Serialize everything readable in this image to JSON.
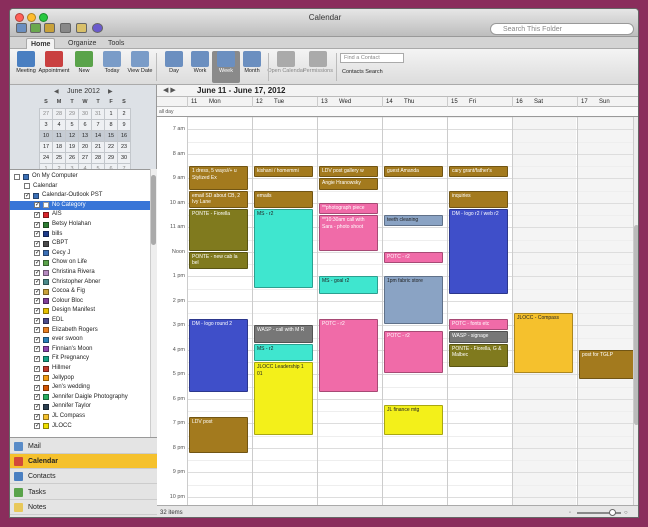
{
  "window": {
    "title": "Calendar",
    "search_placeholder": "Search This Folder"
  },
  "ribbon_tabs": [
    "Home",
    "Organize",
    "Tools"
  ],
  "ribbon_buttons": [
    {
      "label": "Meeting",
      "icon": "meeting-icon",
      "color": "#4a7fc1"
    },
    {
      "label": "Appointment",
      "icon": "appointment-icon",
      "color": "#c94040"
    },
    {
      "label": "New",
      "icon": "new-item-icon",
      "color": "#5aa34a"
    },
    {
      "label": "Today",
      "icon": "today-icon",
      "color": "#7a9cc8"
    },
    {
      "label": "View Date",
      "icon": "view-date-icon",
      "color": "#7a9cc8"
    },
    {
      "label": "Day",
      "icon": "day-view-icon",
      "color": "#6b8fc0"
    },
    {
      "label": "Work",
      "icon": "work-week-icon",
      "color": "#6b8fc0"
    },
    {
      "label": "Week",
      "icon": "week-view-icon",
      "color": "#6b8fc0"
    },
    {
      "label": "Month",
      "icon": "month-view-icon",
      "color": "#6b8fc0"
    },
    {
      "label": "Open Calendar",
      "icon": "open-calendar-icon",
      "color": "#aaaaaa"
    },
    {
      "label": "Permissions",
      "icon": "permissions-icon",
      "color": "#aaaaaa"
    }
  ],
  "find_contact_placeholder": "Find a Contact",
  "contacts_search_label": "Contacts Search",
  "mini_calendar": {
    "title": "June 2012",
    "weekdays": [
      "S",
      "M",
      "T",
      "W",
      "T",
      "F",
      "S"
    ],
    "weeks": [
      [
        "27",
        "28",
        "29",
        "30",
        "31",
        "1",
        "2"
      ],
      [
        "3",
        "4",
        "5",
        "6",
        "7",
        "8",
        "9"
      ],
      [
        "10",
        "11",
        "12",
        "13",
        "14",
        "15",
        "16"
      ],
      [
        "17",
        "18",
        "19",
        "20",
        "21",
        "22",
        "23"
      ],
      [
        "24",
        "25",
        "26",
        "27",
        "28",
        "29",
        "30"
      ],
      [
        "1",
        "2",
        "3",
        "4",
        "5",
        "6",
        "7"
      ]
    ]
  },
  "calendar_tree": [
    {
      "label": "On My Computer",
      "level": 0,
      "checked": false,
      "color": "#3b6fb6"
    },
    {
      "label": "Calendar",
      "level": 1,
      "checked": false,
      "color": ""
    },
    {
      "label": "Calendar-Outlook PST",
      "level": 1,
      "checked": true,
      "color": "#3b6fb6"
    },
    {
      "label": "No Category",
      "level": 2,
      "checked": true,
      "color": "#ffffff",
      "selected": true
    },
    {
      "label": "AIS",
      "level": 2,
      "checked": true,
      "color": "#d8242c"
    },
    {
      "label": "Betsy Holahan",
      "level": 2,
      "checked": true,
      "color": "#2e7d32"
    },
    {
      "label": "bills",
      "level": 2,
      "checked": true,
      "color": "#1d3b8a"
    },
    {
      "label": "CBPT",
      "level": 2,
      "checked": true,
      "color": "#4a4a4a"
    },
    {
      "label": "Cecy J",
      "level": 2,
      "checked": true,
      "color": "#3b6fb6"
    },
    {
      "label": "Chow on Life",
      "level": 2,
      "checked": true,
      "color": "#5aa34a"
    },
    {
      "label": "Christina Rivera",
      "level": 2,
      "checked": true,
      "color": "#b58ac0"
    },
    {
      "label": "Christopher Abner",
      "level": 2,
      "checked": true,
      "color": "#4a8a8a"
    },
    {
      "label": "Cocoa & Fig",
      "level": 2,
      "checked": true,
      "color": "#c9a23b"
    },
    {
      "label": "Colour Bloc",
      "level": 2,
      "checked": true,
      "color": "#7f3f98"
    },
    {
      "label": "Design Manifest",
      "level": 2,
      "checked": true,
      "color": "#e5c100"
    },
    {
      "label": "EDL",
      "level": 2,
      "checked": true,
      "color": "#4a4a8a"
    },
    {
      "label": "Elizabeth Rogers",
      "level": 2,
      "checked": true,
      "color": "#e67e22"
    },
    {
      "label": "ever swoon",
      "level": 2,
      "checked": true,
      "color": "#2980b9"
    },
    {
      "label": "Finnian's Moon",
      "level": 2,
      "checked": true,
      "color": "#8e44ad"
    },
    {
      "label": "Fit Pregnancy",
      "level": 2,
      "checked": true,
      "color": "#16a085"
    },
    {
      "label": "Hillmer",
      "level": 2,
      "checked": true,
      "color": "#c0392b"
    },
    {
      "label": "Jellypop",
      "level": 2,
      "checked": true,
      "color": "#f39c12"
    },
    {
      "label": "Jen's wedding",
      "level": 2,
      "checked": true,
      "color": "#d35400"
    },
    {
      "label": "Jennifer Daigle Photography",
      "level": 2,
      "checked": true,
      "color": "#27ae60"
    },
    {
      "label": "Jennifer Taylor",
      "level": 2,
      "checked": true,
      "color": "#2c3e50"
    },
    {
      "label": "JL Compass",
      "level": 2,
      "checked": true,
      "color": "#f5c12d"
    },
    {
      "label": "JLOCC",
      "level": 2,
      "checked": true,
      "color": "#f0e000"
    }
  ],
  "nav_items": [
    {
      "label": "Mail",
      "icon": "mail-icon",
      "color": "#5a8cc8",
      "active": false
    },
    {
      "label": "Calendar",
      "icon": "calendar-icon",
      "color": "#d24a3a",
      "active": true
    },
    {
      "label": "Contacts",
      "icon": "contacts-icon",
      "color": "#4a7fc1",
      "active": false
    },
    {
      "label": "Tasks",
      "icon": "tasks-icon",
      "color": "#5aa34a",
      "active": false
    },
    {
      "label": "Notes",
      "icon": "notes-icon",
      "color": "#e8c85a",
      "active": false
    }
  ],
  "date_header": {
    "range": "June 11 - June 17, 2012"
  },
  "days": [
    {
      "num": "11",
      "name": "Mon"
    },
    {
      "num": "12",
      "name": "Tue"
    },
    {
      "num": "13",
      "name": "Wed"
    },
    {
      "num": "14",
      "name": "Thu"
    },
    {
      "num": "15",
      "name": "Fri"
    },
    {
      "num": "16",
      "name": "Sat"
    },
    {
      "num": "17",
      "name": "Sun"
    }
  ],
  "all_day_label": "all day",
  "time_labels": [
    "7 am",
    "8 am",
    "9 am",
    "10 am",
    "11 am",
    "Noon",
    "1 pm",
    "2 pm",
    "3 pm",
    "4 pm",
    "5 pm",
    "6 pm",
    "7 pm",
    "8 pm",
    "9 pm",
    "10 pm"
  ],
  "events": [
    {
      "day": 0,
      "start": 8.5,
      "end": 9.5,
      "title": "1 dress, 5 ways//+ u Stylized Ex",
      "color": "#a37a1e"
    },
    {
      "day": 0,
      "start": 9.5,
      "end": 10.25,
      "title": "email SD about CB, 2 Ivy Lane",
      "color": "#a37a1e"
    },
    {
      "day": 0,
      "start": 10.25,
      "end": 12.0,
      "title": "PONTE - Fiorella",
      "color": "#807a1e"
    },
    {
      "day": 0,
      "start": 12.0,
      "end": 12.75,
      "title": "PONTE - new cab la bel",
      "color": "#807a1e"
    },
    {
      "day": 0,
      "start": 14.75,
      "end": 17.75,
      "title": "DM - logo round 2",
      "color": "#3f4fc9"
    },
    {
      "day": 0,
      "start": 18.75,
      "end": 20.25,
      "title": "LDV post",
      "color": "#a37a1e"
    },
    {
      "day": 1,
      "start": 8.5,
      "end": 9.0,
      "title": "kishani / homemmi",
      "color": "#a37a1e"
    },
    {
      "day": 1,
      "start": 9.5,
      "end": 10.25,
      "title": "emails",
      "color": "#a37a1e"
    },
    {
      "day": 1,
      "start": 10.25,
      "end": 13.5,
      "title": "MS - r2",
      "color": "#3fe6cf",
      "dark": true
    },
    {
      "day": 1,
      "start": 15.0,
      "end": 15.75,
      "title": "WASP - call with M R",
      "color": "#777777"
    },
    {
      "day": 1,
      "start": 15.75,
      "end": 16.5,
      "title": "MS - r2",
      "color": "#3fe6cf",
      "dark": true
    },
    {
      "day": 1,
      "start": 16.5,
      "end": 19.5,
      "title": "JLOCC Leadership 1 01",
      "color": "#f3f01a",
      "dark": true
    },
    {
      "day": 2,
      "start": 8.5,
      "end": 9.0,
      "title": "LDV post gallery w",
      "color": "#a37a1e"
    },
    {
      "day": 2,
      "start": 9.0,
      "end": 9.5,
      "title": "Angie Hranowsky",
      "color": "#a37a1e"
    },
    {
      "day": 2,
      "start": 10.0,
      "end": 10.5,
      "title": "**photograph piece",
      "color": "#f06ba8"
    },
    {
      "day": 2,
      "start": 10.5,
      "end": 12.0,
      "title": "**10:30am call with Sara - photo shoot",
      "color": "#f06ba8"
    },
    {
      "day": 2,
      "start": 13.0,
      "end": 13.75,
      "title": "MS - goal r2",
      "color": "#3fe6cf",
      "dark": true
    },
    {
      "day": 2,
      "start": 14.75,
      "end": 17.75,
      "title": "POTC - r2",
      "color": "#f06ba8"
    },
    {
      "day": 3,
      "start": 8.5,
      "end": 9.0,
      "title": "guest Amanda",
      "color": "#a37a1e"
    },
    {
      "day": 3,
      "start": 10.5,
      "end": 11.0,
      "title": "teeth cleaning",
      "color": "#8aa3c4",
      "dark": true
    },
    {
      "day": 3,
      "start": 12.0,
      "end": 12.5,
      "title": "POTC - r2",
      "color": "#f06ba8"
    },
    {
      "day": 3,
      "start": 13.0,
      "end": 15.0,
      "title": "1pm fabric store",
      "color": "#8aa3c4",
      "dark": true
    },
    {
      "day": 3,
      "start": 15.25,
      "end": 17.0,
      "title": "POTC - r2",
      "color": "#f06ba8"
    },
    {
      "day": 3,
      "start": 18.25,
      "end": 19.5,
      "title": "JL finance mtg",
      "color": "#f3f01a",
      "dark": true
    },
    {
      "day": 4,
      "start": 8.5,
      "end": 9.0,
      "title": "cary grant/father's",
      "color": "#a37a1e"
    },
    {
      "day": 4,
      "start": 9.5,
      "end": 10.25,
      "title": "inquiries",
      "color": "#a37a1e"
    },
    {
      "day": 4,
      "start": 10.25,
      "end": 13.75,
      "title": "DM - logo r2 / web r2",
      "color": "#3f4fc9"
    },
    {
      "day": 4,
      "start": 14.75,
      "end": 15.25,
      "title": "POTC - fonts etc",
      "color": "#f06ba8"
    },
    {
      "day": 4,
      "start": 15.25,
      "end": 15.75,
      "title": "WASP - signage",
      "color": "#777777"
    },
    {
      "day": 4,
      "start": 15.75,
      "end": 16.75,
      "title": "PONTE - Fiorella, G & Malbec",
      "color": "#807a1e"
    },
    {
      "day": 5,
      "start": 14.5,
      "end": 17.0,
      "title": "JLOCC - Compass",
      "color": "#f5c12d",
      "dark": true
    },
    {
      "day": 6,
      "start": 16.0,
      "end": 17.25,
      "title": "post for TGLP",
      "color": "#a37a1e"
    }
  ],
  "status": {
    "items": "32 items"
  }
}
